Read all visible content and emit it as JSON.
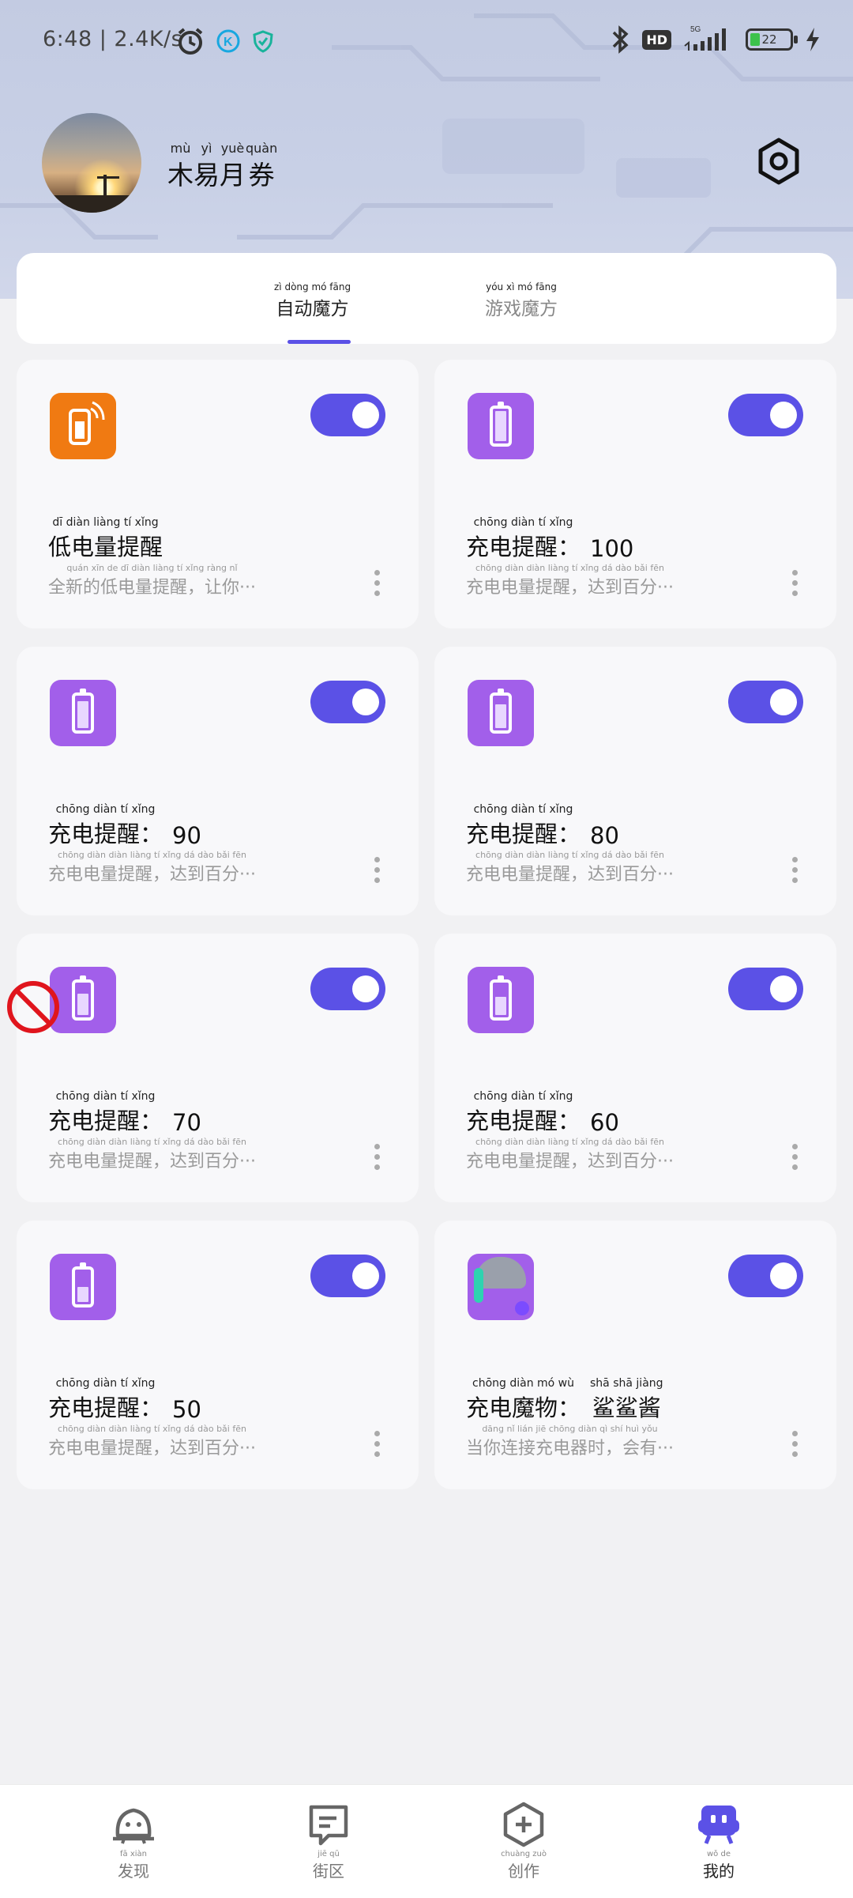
{
  "status_bar": {
    "time": "6:48",
    "speed": "2.4K/s",
    "battery_level": "22",
    "hd_label": "HD",
    "network": "5G"
  },
  "profile": {
    "name_chars": [
      {
        "rt": "mù",
        "ch": "木"
      },
      {
        "rt": "yì",
        "ch": "易"
      },
      {
        "rt": "yuè",
        "ch": "月"
      },
      {
        "rt": "quàn",
        "ch": "券"
      }
    ]
  },
  "tabs": [
    {
      "label": "自动魔方",
      "pinyin": "zì dòng mó fāng",
      "active": true
    },
    {
      "label": "游戏魔方",
      "pinyin": "yóu xì mó fāng",
      "active": false
    }
  ],
  "cards": [
    {
      "title": "低电量提醒",
      "title_pinyin": "dī diàn liàng tí xǐng",
      "value": "",
      "desc": "全新的低电量提醒，让你···",
      "desc_pinyin": "quán xīn de dī diàn liàng tí xǐng ràng nǐ",
      "icon": "signal-phone-icon",
      "enabled": true
    },
    {
      "title": "充电提醒：",
      "title_pinyin": "chōng diàn tí xǐng",
      "value": "100",
      "desc": "充电电量提醒，达到百分···",
      "desc_pinyin": "chōng diàn diàn liàng tí xǐng dá dào bǎi fēn",
      "icon": "battery-icon",
      "level": 1.0,
      "enabled": true
    },
    {
      "title": "充电提醒：",
      "title_pinyin": "chōng diàn tí xǐng",
      "value": "90",
      "desc": "充电电量提醒，达到百分···",
      "desc_pinyin": "chōng diàn diàn liàng tí xǐng dá dào bǎi fēn",
      "icon": "battery-icon",
      "level": 0.9,
      "enabled": true
    },
    {
      "title": "充电提醒：",
      "title_pinyin": "chōng diàn tí xǐng",
      "value": "80",
      "desc": "充电电量提醒，达到百分···",
      "desc_pinyin": "chōng diàn diàn liàng tí xǐng dá dào bǎi fēn",
      "icon": "battery-icon",
      "level": 0.8,
      "enabled": true
    },
    {
      "title": "充电提醒：",
      "title_pinyin": "chōng diàn tí xǐng",
      "value": "70",
      "desc": "充电电量提醒，达到百分···",
      "desc_pinyin": "chōng diàn diàn liàng tí xǐng dá dào bǎi fēn",
      "icon": "battery-icon",
      "level": 0.7,
      "enabled": true,
      "blocked": true
    },
    {
      "title": "充电提醒：",
      "title_pinyin": "chōng diàn tí xǐng",
      "value": "60",
      "desc": "充电电量提醒，达到百分···",
      "desc_pinyin": "chōng diàn diàn liàng tí xǐng dá dào bǎi fēn",
      "icon": "battery-icon",
      "level": 0.6,
      "enabled": true
    },
    {
      "title": "充电提醒：",
      "title_pinyin": "chōng diàn tí xǐng",
      "value": "50",
      "desc": "充电电量提醒，达到百分···",
      "desc_pinyin": "chōng diàn diàn liàng tí xǐng dá dào bǎi fēn",
      "icon": "battery-icon",
      "level": 0.5,
      "enabled": true
    },
    {
      "title": "充电魔物：",
      "title_pinyin": "chōng diàn mó wù",
      "value": "鲨鲨酱",
      "value_pinyin": "shā shā jiàng",
      "desc": "当你连接充电器时，会有···",
      "desc_pinyin": "dāng nǐ lián jiē chōng diàn qì shí huì yǒu",
      "icon": "anime-character-icon",
      "enabled": true
    }
  ],
  "bottom_nav": [
    {
      "label": "发现",
      "pinyin": "fā xiàn",
      "icon": "discover-icon",
      "active": false
    },
    {
      "label": "街区",
      "pinyin": "jiē qū",
      "icon": "community-icon",
      "active": false
    },
    {
      "label": "创作",
      "pinyin": "chuàng zuò",
      "icon": "create-icon",
      "active": false
    },
    {
      "label": "我的",
      "pinyin": "wǒ de",
      "icon": "profile-icon",
      "active": true
    }
  ],
  "colors": {
    "accent": "#5b51e6",
    "card_icon_purple": "#a25fea",
    "card_icon_orange": "#f07a12",
    "header_bg": "#c8d0e6",
    "page_bg": "#f1f1f3"
  }
}
